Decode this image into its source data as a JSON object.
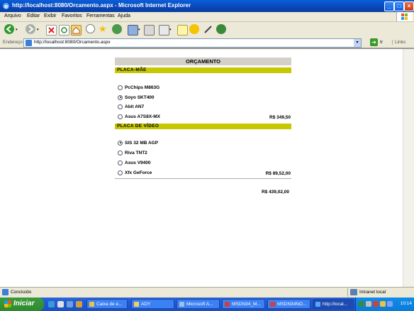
{
  "window": {
    "title": "http://localhost:8080/Orcamento.aspx - Microsoft Internet Explorer"
  },
  "menu": [
    "Arquivo",
    "Editar",
    "Exibir",
    "Favoritos",
    "Ferramentas",
    "Ajuda"
  ],
  "address": {
    "label": "Endereço",
    "url": "http://localhost:8080/Orcamento.aspx",
    "go_label": "Ir",
    "links_label": "Links"
  },
  "form": {
    "title": "ORÇAMENTO",
    "sections": [
      {
        "name": "PLACA-MÃE",
        "options": [
          {
            "label": "PcChips M863G",
            "selected": false
          },
          {
            "label": "Soyo SKT400",
            "selected": true
          },
          {
            "label": "Abit AN7",
            "selected": false
          },
          {
            "label": "Asus A7S8X-MX",
            "selected": false
          }
        ],
        "price": "R$ 349,50"
      },
      {
        "name": "PLACA DE VÍDEO",
        "options": [
          {
            "label": "SIS 32 MB AGP",
            "selected": true
          },
          {
            "label": "Riva TNT2",
            "selected": false
          },
          {
            "label": "Asus V9400",
            "selected": false
          },
          {
            "label": "Xfx GeForce",
            "selected": false
          }
        ],
        "price": "R$ 89,52,00"
      }
    ],
    "total": "R$ 439,02,00"
  },
  "status": {
    "text": "Concluído",
    "zone": "Intranet local"
  },
  "taskbar": {
    "start_label": "Iniciar",
    "tasks": [
      "Caixa de e...",
      "ADY",
      "Microsoft A...",
      "MSDN34_M...",
      "MSDN34NO...",
      "http://local..."
    ],
    "clock": "10:14"
  },
  "colors": {
    "section_bar": "#c8c800",
    "header_bar": "#d4d0c8",
    "title_bar": "#0846b8"
  }
}
